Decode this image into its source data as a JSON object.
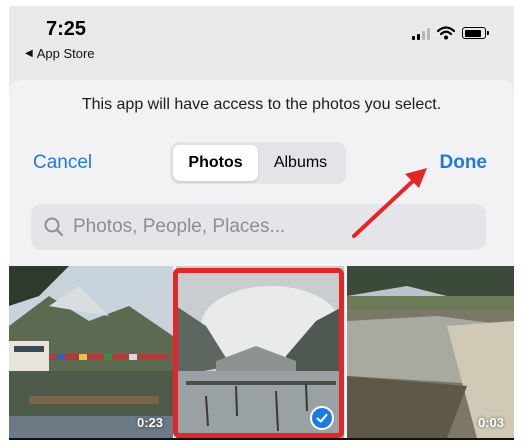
{
  "status_bar": {
    "time": "7:25",
    "back_app_label": "App Store",
    "icons": [
      "signal-icon",
      "wifi-icon",
      "battery-icon"
    ]
  },
  "picker": {
    "prompt": "This app will have access to the photos you select.",
    "cancel_label": "Cancel",
    "done_label": "Done",
    "tabs": [
      {
        "label": "Photos",
        "selected": true
      },
      {
        "label": "Albums",
        "selected": false
      }
    ],
    "search_placeholder": "Photos, People, Places..."
  },
  "photos": [
    {
      "duration": "0:23",
      "selected": false
    },
    {
      "duration": "",
      "selected": true
    },
    {
      "duration": "0:03",
      "selected": false
    }
  ],
  "colors": {
    "accent": "#1f7ae0",
    "annotation": "#e32626"
  }
}
